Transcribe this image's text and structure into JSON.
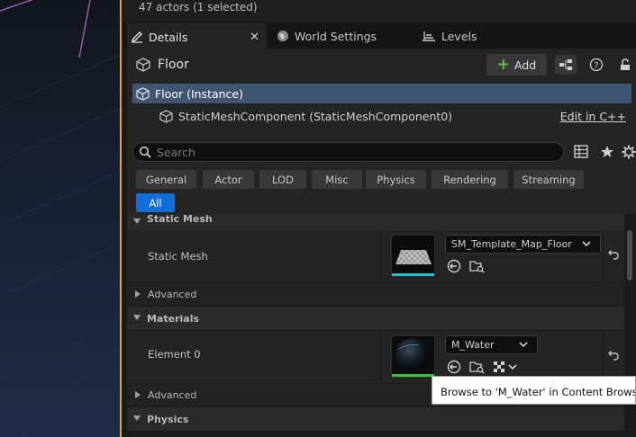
{
  "actors_bar": {
    "text": "47 actors (1 selected)"
  },
  "tabs": [
    {
      "label": "Details",
      "icon": "pencil-icon",
      "active": true
    },
    {
      "label": "World Settings",
      "icon": "globe-icon",
      "active": false
    },
    {
      "label": "Levels",
      "icon": "layers-icon",
      "active": false
    }
  ],
  "header": {
    "title": "Floor",
    "add_label": "Add"
  },
  "tree": {
    "root": "Floor (Instance)",
    "child": "StaticMeshComponent (StaticMeshComponent0)",
    "edit_link": "Edit in C++"
  },
  "search": {
    "placeholder": "Search"
  },
  "filter_chips": [
    "General",
    "Actor",
    "LOD",
    "Misc",
    "Physics",
    "Rendering",
    "Streaming",
    "All"
  ],
  "active_filter": "All",
  "properties": {
    "static_mesh_section": "Static Mesh",
    "static_mesh_label": "Static Mesh",
    "static_mesh_value": "SM_Template_Map_Floor",
    "advanced_label": "Advanced",
    "materials_section": "Materials",
    "element0_label": "Element 0",
    "element0_value": "M_Water",
    "physics_section": "Physics"
  },
  "tooltip": {
    "text": "Browse to 'M_Water' in Content Browser"
  },
  "colors": {
    "accent": "#0f6fd6",
    "selection": "#3f5571",
    "viewport_border": "#e8a317",
    "add_plus": "#5ac43a"
  }
}
